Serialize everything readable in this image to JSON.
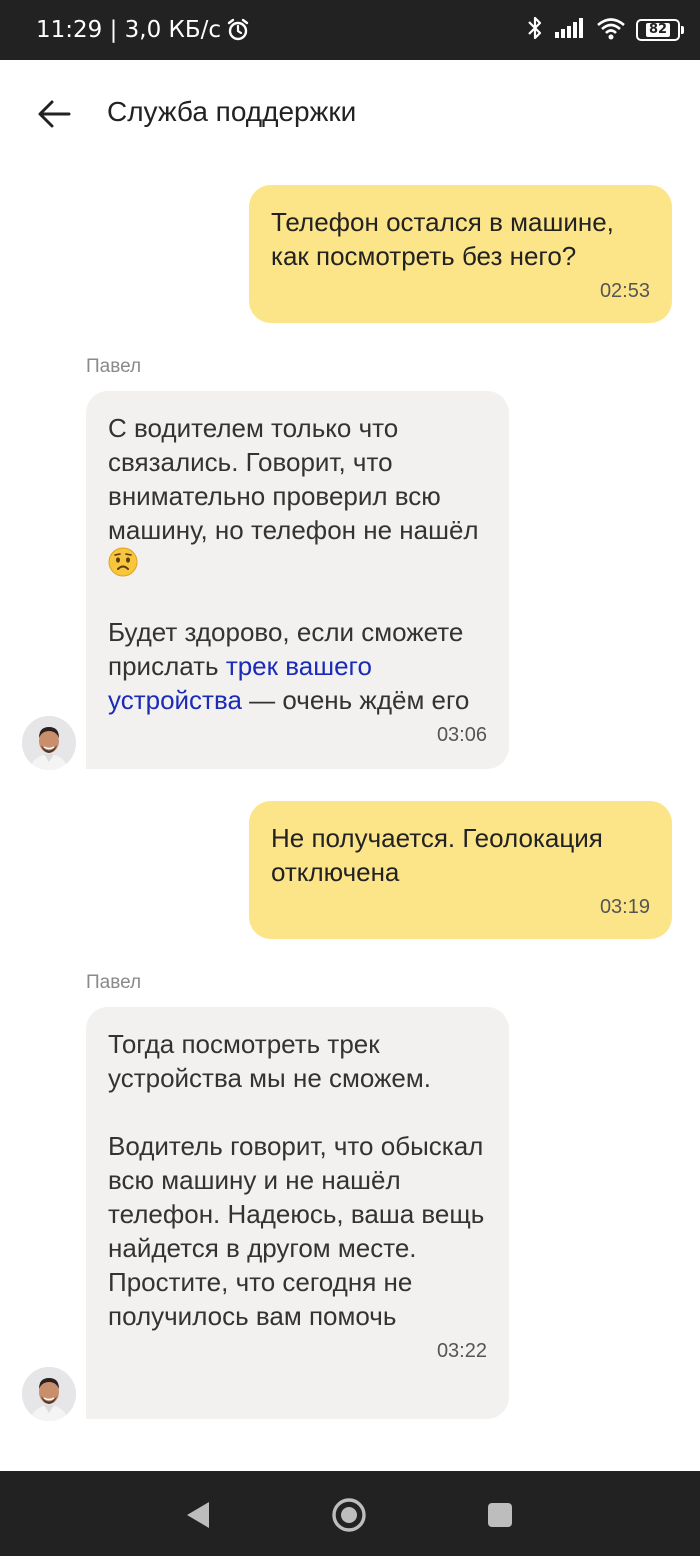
{
  "status_bar": {
    "time_and_speed": "11:29 | 3,0 КБ/с",
    "battery": "82"
  },
  "header": {
    "title": "Служба поддержки"
  },
  "messages": [
    {
      "from": "me",
      "text": "Телефон остался в машине,\nкак посмотреть без него?",
      "time": "02:53"
    },
    {
      "from": "agent",
      "sender": "Павел",
      "text": "С водителем только что связались. Говорит, что внимательно проверил всю машину, но телефон не нашёл",
      "text2_before": "Будет здорово, если сможете прислать ",
      "link": "трек вашего устройства",
      "text2_after": " — очень ждём его",
      "time": "03:06"
    },
    {
      "from": "me",
      "text": "Не получается. Геолокация\nотключена",
      "time": "03:19"
    },
    {
      "from": "agent",
      "sender": "Павел",
      "text": "Тогда посмотреть трек устройства мы не сможем.\n\nВодитель говорит, что обыскал всю машину и не нашёл телефон. Надеюсь, ваша вещь найдется в другом месте.\nПростите, что сегодня не получилось вам помочь",
      "time": "03:22"
    }
  ],
  "colors": {
    "outgoing_bubble": "#fce589",
    "incoming_bubble": "#f2f1f0",
    "link": "#1a2bb8",
    "system_bars": "#222222"
  },
  "icons": [
    "alarm-icon",
    "bluetooth-icon",
    "signal-icon",
    "wifi-icon",
    "battery-icon",
    "back-arrow-icon",
    "worried-face-emoji",
    "nav-back-icon",
    "nav-home-icon",
    "nav-recents-icon"
  ]
}
